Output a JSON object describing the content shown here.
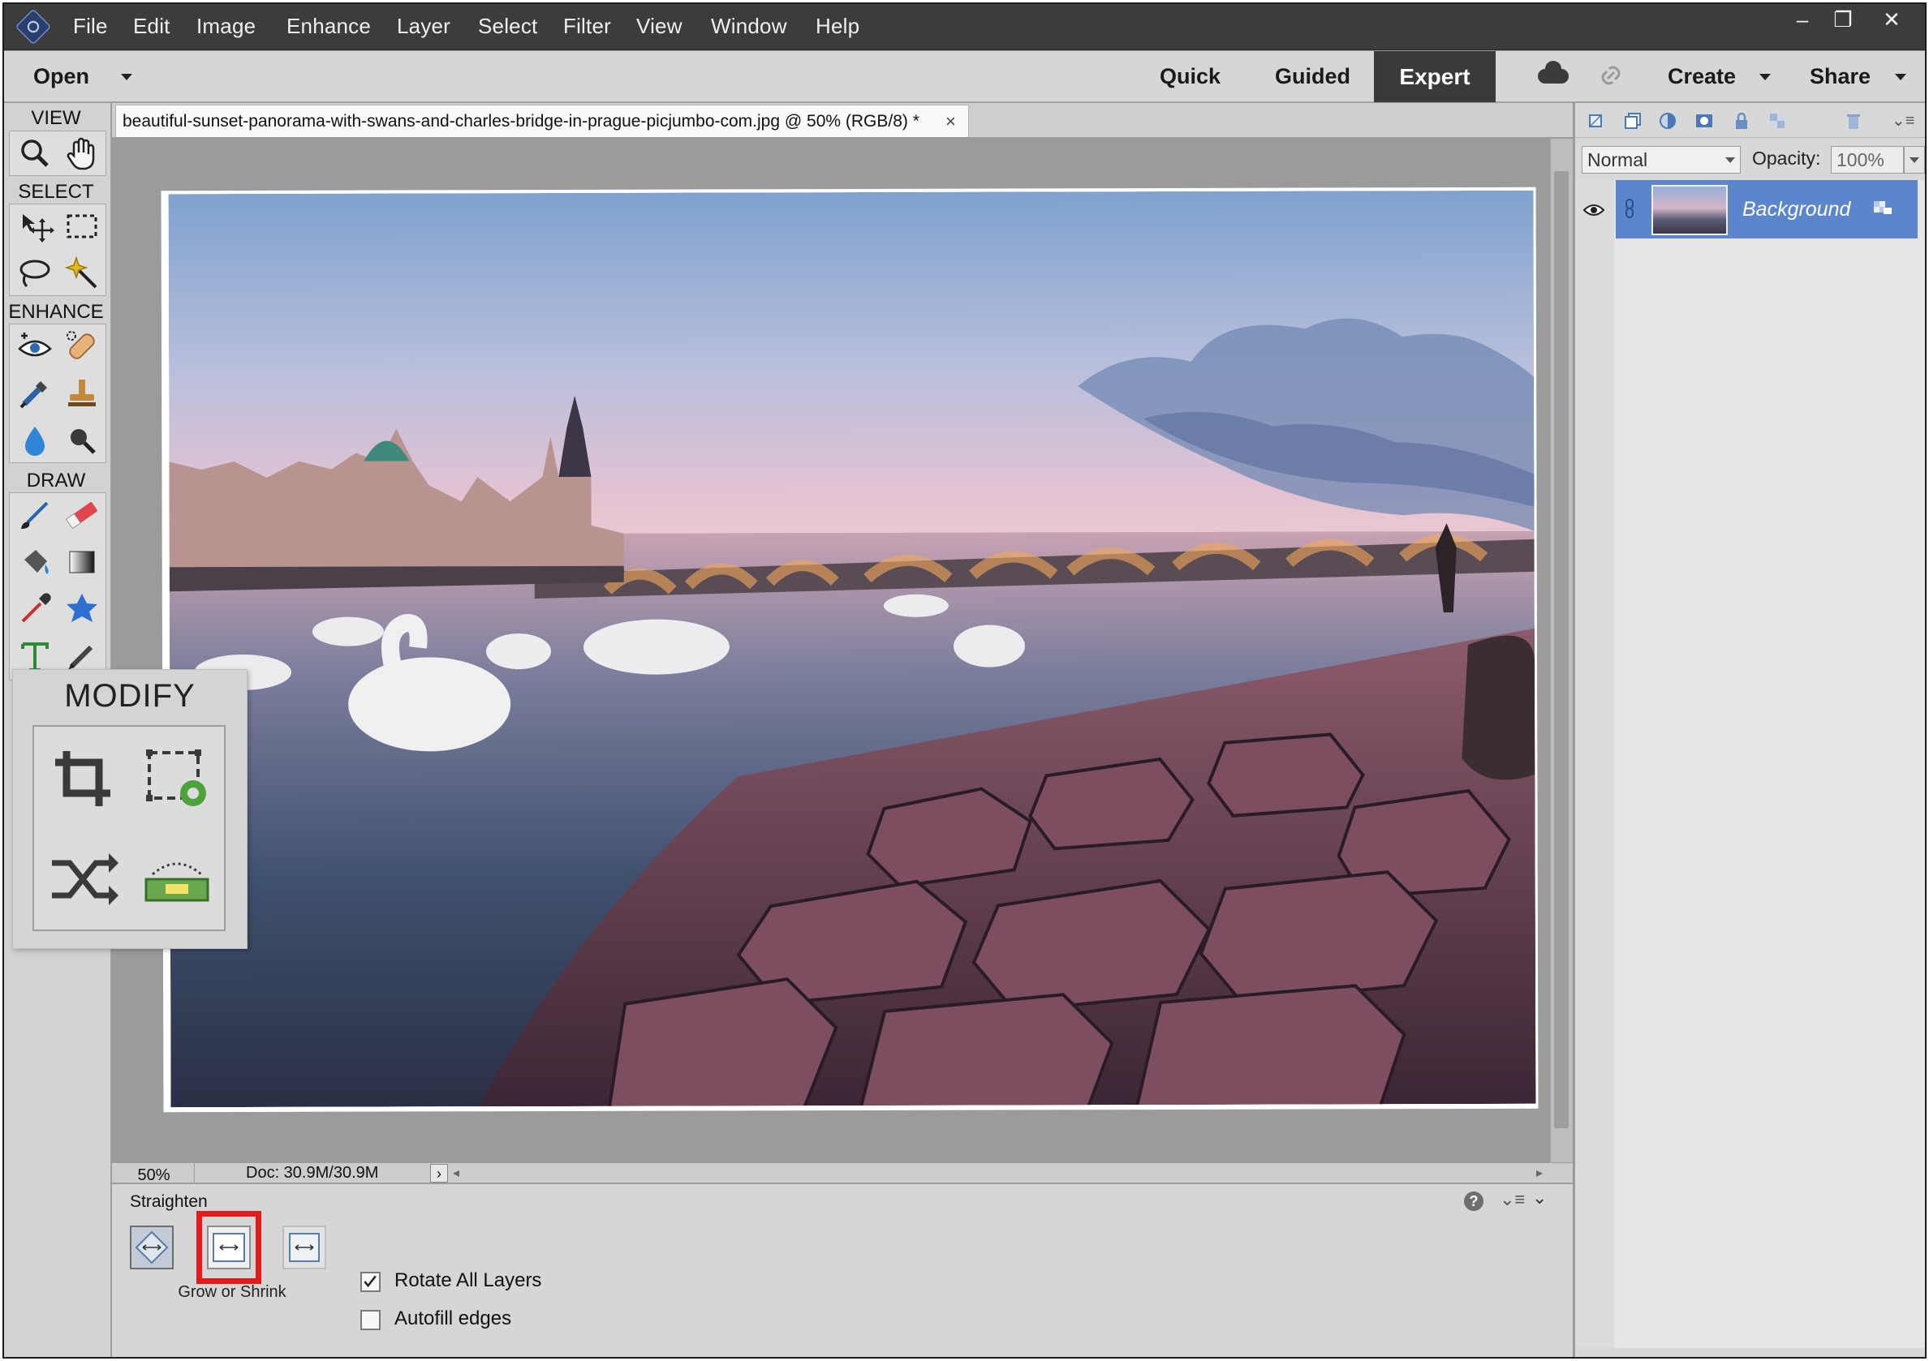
{
  "menubar": {
    "logo": "photoshop-elements-logo",
    "items": [
      "File",
      "Edit",
      "Image",
      "Enhance",
      "Layer",
      "Select",
      "Filter",
      "View",
      "Window",
      "Help"
    ],
    "window_controls": [
      "–",
      "❐",
      "✕"
    ]
  },
  "modebar": {
    "open_label": "Open",
    "modes": [
      "Quick",
      "Guided",
      "Expert"
    ],
    "active_mode": "Expert",
    "create_label": "Create",
    "share_label": "Share"
  },
  "toolbox": {
    "sections": {
      "view": "VIEW",
      "select": "SELECT",
      "enhance": "ENHANCE",
      "draw": "DRAW"
    },
    "tools": {
      "view": [
        "zoom-tool",
        "hand-tool"
      ],
      "select": [
        "move-tool",
        "marquee-tool",
        "lasso-tool",
        "magic-wand-tool"
      ],
      "enhance": [
        "red-eye-tool",
        "spot-healing-tool",
        "smart-brush-tool",
        "clone-stamp-tool",
        "blur-tool",
        "sponge-tool"
      ],
      "draw": [
        "brush-tool",
        "eraser-tool",
        "paint-bucket-tool",
        "gradient-tool",
        "eyedropper-tool",
        "custom-shape-tool",
        "type-tool",
        "pencil-tool"
      ]
    }
  },
  "document": {
    "tab_title": "beautiful-sunset-panorama-with-swans-and-charles-bridge-in-prague-picjumbo-com.jpg @ 50% (RGB/8) *",
    "close": "×"
  },
  "status": {
    "zoom": "50%",
    "doc_size": "Doc: 30.9M/30.9M",
    "arrow": "›"
  },
  "modify_flyout": {
    "title": "MODIFY",
    "tools": [
      "crop-tool",
      "recompose-tool",
      "content-aware-move-tool",
      "straighten-tool"
    ]
  },
  "options": {
    "tool_name": "Straighten",
    "mode_buttons": [
      "remove-background",
      "grow-or-shrink",
      "crop-to-original"
    ],
    "selected_mode": "grow-or-shrink",
    "mode_label": "Grow or Shrink",
    "rotate_all_layers": {
      "label": "Rotate All Layers",
      "checked": true
    },
    "autofill_edges": {
      "label": "Autofill edges",
      "checked": false
    },
    "help": "?"
  },
  "layers": {
    "blend_mode": "Normal",
    "opacity_label": "Opacity:",
    "opacity_value": "100%",
    "items": [
      {
        "name": "Background",
        "visible": true,
        "selected": true
      }
    ]
  },
  "colors": {
    "menubar_bg": "#3c3c3c",
    "panel_bg": "#d6d6d6",
    "canvas_bg": "#9b9b9b",
    "layer_selected": "#5b86cc",
    "highlight": "#e41a1c"
  }
}
